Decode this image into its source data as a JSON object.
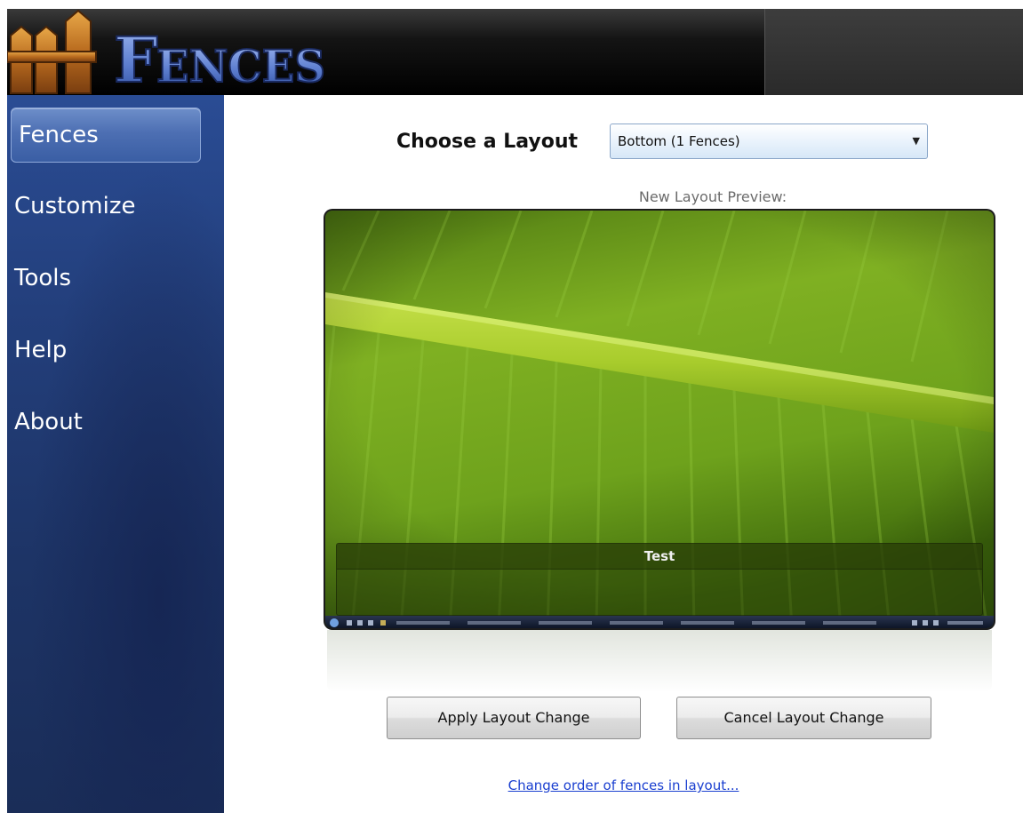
{
  "app": {
    "logo_text": "Fences"
  },
  "sidebar": {
    "items": [
      {
        "label": "Fences",
        "active": true
      },
      {
        "label": "Customize",
        "active": false
      },
      {
        "label": "Tools",
        "active": false
      },
      {
        "label": "Help",
        "active": false
      },
      {
        "label": "About",
        "active": false
      }
    ]
  },
  "main": {
    "layout_label": "Choose a Layout",
    "layout_select_value": "Bottom (1 Fences)",
    "preview_label": "New Layout Preview:",
    "preview_fence_title": "Test",
    "apply_button": "Apply Layout Change",
    "cancel_button": "Cancel Layout Change",
    "order_link": "Change order of fences in layout..."
  },
  "colors": {
    "sidebar": "#233f7c",
    "link": "#1a3fd0",
    "leaf_green": "#7fb022"
  },
  "icons": {
    "select_arrow": "chevron-down-icon"
  }
}
